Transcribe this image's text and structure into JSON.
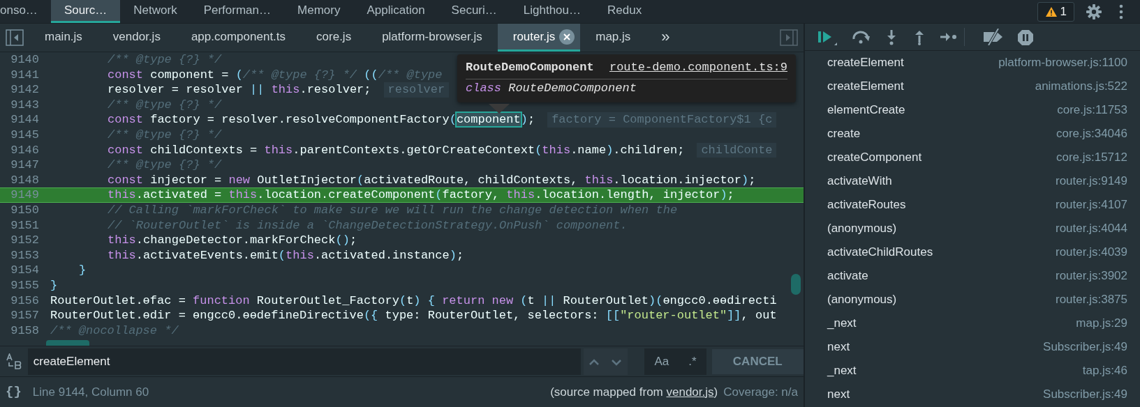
{
  "top_tabs": [
    {
      "label": "onso…",
      "selected": false
    },
    {
      "label": "Sourc…",
      "selected": true
    },
    {
      "label": "Network",
      "selected": false
    },
    {
      "label": "Performan…",
      "selected": false
    },
    {
      "label": "Memory",
      "selected": false
    },
    {
      "label": "Application",
      "selected": false
    },
    {
      "label": "Securi…",
      "selected": false
    },
    {
      "label": "Lighthou…",
      "selected": false
    },
    {
      "label": "Redux",
      "selected": false
    }
  ],
  "warnings": {
    "count": "1"
  },
  "file_tabs": [
    {
      "label": "main.js",
      "selected": false,
      "closable": false
    },
    {
      "label": "vendor.js",
      "selected": false,
      "closable": false
    },
    {
      "label": "app.component.ts",
      "selected": false,
      "closable": false
    },
    {
      "label": "core.js",
      "selected": false,
      "closable": false
    },
    {
      "label": "platform-browser.js",
      "selected": false,
      "closable": false
    },
    {
      "label": "router.js",
      "selected": true,
      "closable": true
    },
    {
      "label": "map.js",
      "selected": false,
      "closable": false
    }
  ],
  "file_tabs_overflow": "»",
  "editor": {
    "lines": [
      {
        "number": "9140",
        "kind": "body",
        "highlighted": false,
        "segments": [
          {
            "kind": "comment",
            "text": "/** @type {?} */"
          }
        ]
      },
      {
        "number": "9141",
        "kind": "body",
        "highlighted": false,
        "segments": [
          {
            "kind": "keyword",
            "text": "const"
          },
          {
            "kind": "plain",
            "text": " component = "
          },
          {
            "kind": "punct",
            "text": "("
          },
          {
            "kind": "comment",
            "text": "/** @type {?} */"
          },
          {
            "kind": "punct",
            "text": " (("
          },
          {
            "kind": "comment",
            "text": "/** @type"
          }
        ]
      },
      {
        "number": "9142",
        "kind": "body",
        "highlighted": false,
        "segments": [
          {
            "kind": "plain",
            "text": "resolver = resolver "
          },
          {
            "kind": "punct",
            "text": "|| "
          },
          {
            "kind": "keyword",
            "text": "this"
          },
          {
            "kind": "plain",
            "text": ".resolver;"
          }
        ],
        "hint": "resolver"
      },
      {
        "number": "9143",
        "kind": "body",
        "highlighted": false,
        "segments": [
          {
            "kind": "comment",
            "text": "/** @type {?} */"
          }
        ]
      },
      {
        "number": "9144",
        "kind": "body",
        "highlighted": false,
        "segments": [
          {
            "kind": "keyword",
            "text": "const"
          },
          {
            "kind": "plain",
            "text": " factory = resolver.resolveComponentFactory"
          },
          {
            "kind": "punct",
            "text": "("
          },
          {
            "kind": "match",
            "text": "component"
          },
          {
            "kind": "punct",
            "text": ")"
          },
          {
            "kind": "plain",
            "text": ";"
          }
        ],
        "hint": "factory = ComponentFactory$1 {c"
      },
      {
        "number": "9145",
        "kind": "body",
        "highlighted": false,
        "segments": [
          {
            "kind": "comment",
            "text": "/** @type {?} */"
          }
        ]
      },
      {
        "number": "9146",
        "kind": "body",
        "highlighted": false,
        "segments": [
          {
            "kind": "keyword",
            "text": "const"
          },
          {
            "kind": "plain",
            "text": " childContexts = "
          },
          {
            "kind": "keyword",
            "text": "this"
          },
          {
            "kind": "plain",
            "text": ".parentContexts.getOrCreateContext"
          },
          {
            "kind": "punct",
            "text": "("
          },
          {
            "kind": "keyword",
            "text": "this"
          },
          {
            "kind": "plain",
            "text": ".name"
          },
          {
            "kind": "punct",
            "text": ")"
          },
          {
            "kind": "plain",
            "text": ".children;"
          }
        ],
        "hint": "childConte"
      },
      {
        "number": "9147",
        "kind": "body",
        "highlighted": false,
        "segments": [
          {
            "kind": "comment",
            "text": "/** @type {?} */"
          }
        ]
      },
      {
        "number": "9148",
        "kind": "body",
        "highlighted": false,
        "segments": [
          {
            "kind": "keyword",
            "text": "const"
          },
          {
            "kind": "plain",
            "text": " injector = "
          },
          {
            "kind": "keyword",
            "text": "new"
          },
          {
            "kind": "plain",
            "text": " OutletInjector"
          },
          {
            "kind": "punct",
            "text": "("
          },
          {
            "kind": "plain",
            "text": "activatedRoute, childContexts, "
          },
          {
            "kind": "keyword",
            "text": "this"
          },
          {
            "kind": "plain",
            "text": ".location.injector"
          },
          {
            "kind": "punct",
            "text": ")"
          },
          {
            "kind": "plain",
            "text": ";"
          }
        ]
      },
      {
        "number": "9149",
        "kind": "body",
        "highlighted": true,
        "segments": [
          {
            "kind": "keyword",
            "text": "this"
          },
          {
            "kind": "plain",
            "text": ".activated = "
          },
          {
            "kind": "keyword",
            "text": "this"
          },
          {
            "kind": "plain",
            "text": ".location.createComponent"
          },
          {
            "kind": "punct",
            "text": "("
          },
          {
            "kind": "plain",
            "text": "factory, "
          },
          {
            "kind": "keyword",
            "text": "this"
          },
          {
            "kind": "plain",
            "text": ".location.length, injector"
          },
          {
            "kind": "punct",
            "text": ")"
          },
          {
            "kind": "plain",
            "text": ";"
          }
        ]
      },
      {
        "number": "9150",
        "kind": "body",
        "highlighted": false,
        "segments": [
          {
            "kind": "comment",
            "text": "// Calling `markForCheck` to make sure we will run the change detection when the"
          }
        ]
      },
      {
        "number": "9151",
        "kind": "body",
        "highlighted": false,
        "segments": [
          {
            "kind": "comment",
            "text": "// `RouterOutlet` is inside a `ChangeDetectionStrategy.OnPush` component."
          }
        ]
      },
      {
        "number": "9152",
        "kind": "body",
        "highlighted": false,
        "segments": [
          {
            "kind": "keyword",
            "text": "this"
          },
          {
            "kind": "plain",
            "text": ".changeDetector.markForCheck"
          },
          {
            "kind": "punct",
            "text": "()"
          },
          {
            "kind": "plain",
            "text": ";"
          }
        ]
      },
      {
        "number": "9153",
        "kind": "body",
        "highlighted": false,
        "segments": [
          {
            "kind": "keyword",
            "text": "this"
          },
          {
            "kind": "plain",
            "text": ".activateEvents.emit"
          },
          {
            "kind": "punct",
            "text": "("
          },
          {
            "kind": "keyword",
            "text": "this"
          },
          {
            "kind": "plain",
            "text": ".activated.instance"
          },
          {
            "kind": "punct",
            "text": ")"
          },
          {
            "kind": "plain",
            "text": ";"
          }
        ]
      },
      {
        "number": "9154",
        "kind": "method-end",
        "highlighted": false,
        "segments": [
          {
            "kind": "punct",
            "text": "}"
          }
        ]
      },
      {
        "number": "9155",
        "kind": "top",
        "highlighted": false,
        "segments": [
          {
            "kind": "punct",
            "text": "}"
          }
        ]
      },
      {
        "number": "9156",
        "kind": "top",
        "highlighted": false,
        "segments": [
          {
            "kind": "plain",
            "text": "RouterOutlet.ɵfac = "
          },
          {
            "kind": "keyword",
            "text": "function"
          },
          {
            "kind": "plain",
            "text": " RouterOutlet_Factory"
          },
          {
            "kind": "punct",
            "text": "("
          },
          {
            "kind": "plain",
            "text": "t"
          },
          {
            "kind": "punct",
            "text": ") { "
          },
          {
            "kind": "keyword",
            "text": "return new"
          },
          {
            "kind": "punct",
            "text": " ("
          },
          {
            "kind": "plain",
            "text": "t "
          },
          {
            "kind": "punct",
            "text": "||"
          },
          {
            "kind": "plain",
            "text": " RouterOutlet"
          },
          {
            "kind": "punct",
            "text": ")("
          },
          {
            "kind": "plain",
            "text": "ɵngcc0.ɵɵdirecti"
          }
        ]
      },
      {
        "number": "9157",
        "kind": "top",
        "highlighted": false,
        "segments": [
          {
            "kind": "plain",
            "text": "RouterOutlet.ɵdir = ɵngcc0.ɵɵdefineDirective"
          },
          {
            "kind": "punct",
            "text": "({"
          },
          {
            "kind": "plain",
            "text": " type: RouterOutlet, selectors: "
          },
          {
            "kind": "punct",
            "text": "[["
          },
          {
            "kind": "string",
            "text": "\"router-outlet\""
          },
          {
            "kind": "punct",
            "text": "]]"
          },
          {
            "kind": "plain",
            "text": ", out"
          }
        ]
      },
      {
        "number": "9158",
        "kind": "top",
        "highlighted": false,
        "segments": [
          {
            "kind": "comment",
            "text": "/** @nocollapse */"
          }
        ]
      }
    ],
    "tooltip": {
      "title": "RouteDemoComponent",
      "link": "route-demo.component.ts:9",
      "keyword": "class",
      "name": "RouteDemoComponent"
    }
  },
  "search": {
    "value": "createElement",
    "match_case": "Aa",
    "regex": ".*",
    "cancel": "CANCEL"
  },
  "status_bar": {
    "format_icon": "{}",
    "position": "Line 9144, Column 60",
    "source_prefix": "(source mapped from ",
    "source_link": "vendor.js",
    "source_suffix": ")",
    "coverage": "Coverage: n/a"
  },
  "call_stack": [
    {
      "function": "createElement",
      "location": "platform-browser.js:1100"
    },
    {
      "function": "createElement",
      "location": "animations.js:522"
    },
    {
      "function": "elementCreate",
      "location": "core.js:11753"
    },
    {
      "function": "create",
      "location": "core.js:34046"
    },
    {
      "function": "createComponent",
      "location": "core.js:15712"
    },
    {
      "function": "activateWith",
      "location": "router.js:9149"
    },
    {
      "function": "activateRoutes",
      "location": "router.js:4107"
    },
    {
      "function": "(anonymous)",
      "location": "router.js:4044"
    },
    {
      "function": "activateChildRoutes",
      "location": "router.js:4039"
    },
    {
      "function": "activate",
      "location": "router.js:3902"
    },
    {
      "function": "(anonymous)",
      "location": "router.js:3875"
    },
    {
      "function": "_next",
      "location": "map.js:29"
    },
    {
      "function": "next",
      "location": "Subscriber.js:49"
    },
    {
      "function": "_next",
      "location": "tap.js:46"
    },
    {
      "function": "next",
      "location": "Subscriber.js:49"
    }
  ]
}
